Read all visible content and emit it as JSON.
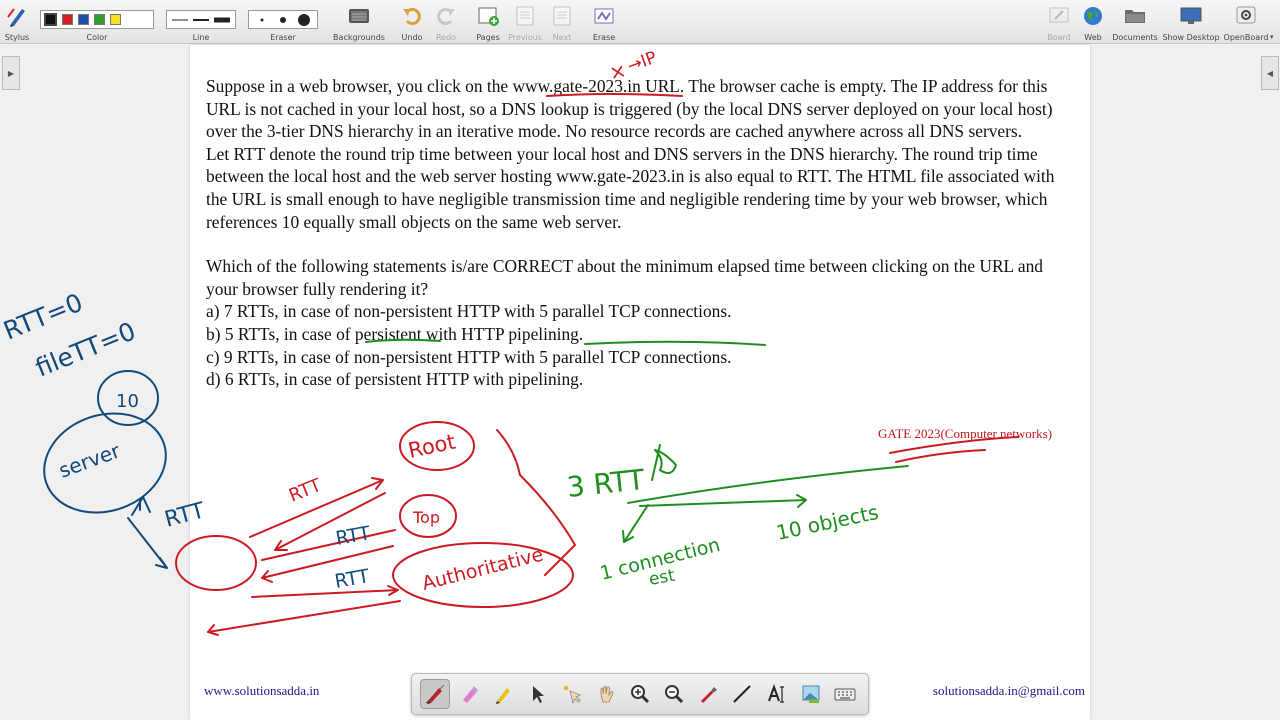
{
  "toolbar": {
    "stylus": "Stylus",
    "color": "Color",
    "line": "Line",
    "eraser": "Eraser",
    "backgrounds": "Backgrounds",
    "undo": "Undo",
    "redo": "Redo",
    "pages": "Pages",
    "previous": "Previous",
    "next": "Next",
    "erase": "Erase",
    "board": "Board",
    "web": "Web",
    "documents": "Documents",
    "show_desktop": "Show Desktop",
    "openboard": "OpenBoard"
  },
  "colors": {
    "swatches": [
      "#111111",
      "#d81e1e",
      "#1e4fa8",
      "#2ea02e",
      "#f2e21a"
    ],
    "ink_red": "#cc1a22",
    "ink_blue": "#114a7a",
    "ink_green": "#1e8e1e",
    "brand_red": "#c0171c",
    "footer_blue": "#1b1a8a"
  },
  "question": {
    "p1_before": "Suppose in a web browser, you click on the ",
    "p1_url": "www.gate-2023.in",
    "p1_after": " URL. The browser cache is empty. The IP address for this URL is not cached in your local host, so a DNS lookup is triggered (by the local DNS server deployed on your local host) over the 3-tier DNS hierarchy in an iterative mode. No resource records are cached anywhere across all DNS servers.",
    "p2": "Let RTT denote the round trip time between your local host and DNS servers in the DNS hierarchy. The round trip time between the local host and the web server hosting www.gate-2023.in is also equal to RTT. The HTML file associated with the URL is small enough to have negligible transmission time and negligible rendering time by your web browser, which references 10 equally small objects on the same web server.",
    "p3": "Which of the following statements is/are CORRECT about the minimum elapsed time between clicking on the URL and your browser fully rendering it?",
    "option_a": "a) 7 RTTs, in case of non-persistent HTTP with 5 parallel TCP connections.",
    "option_b": "b) 5 RTTs, in case of persistent with HTTP pipelining.",
    "option_c": "c) 9 RTTs, in case of non-persistent HTTP with 5 parallel TCP connections.",
    "option_d": "d) 6 RTTs, in case of persistent HTTP with pipelining."
  },
  "brand_header": "GATE 2023(Computer networks)",
  "footer": {
    "left": "www.solutionsadda.in",
    "right": "solutionsadda.in@gmail.com"
  },
  "annotations": {
    "ip": "→IP",
    "x_mark": "×",
    "rtt_zero": "RTT=0",
    "file_tt": "fileTT=0",
    "ten": "10",
    "server": "server",
    "rtt_vertical": "RTT",
    "rtt_1": "RTT",
    "rtt_2": "RTT",
    "rtt_3": "RTT",
    "root": "Root",
    "top": "Top",
    "authoritative": "Authoritative",
    "three_rtt": "3 RTT",
    "one_connection": "1 connection",
    "est": "est",
    "ten_objects": "10 objects"
  },
  "palette": {
    "tools": [
      "pen-icon",
      "marker-icon",
      "highlighter-icon",
      "pointer-icon",
      "laser-icon",
      "hand-icon",
      "zoom-in-icon",
      "zoom-out-icon",
      "pipette-icon",
      "line-icon",
      "text-icon",
      "capture-icon",
      "keyboard-icon"
    ]
  }
}
